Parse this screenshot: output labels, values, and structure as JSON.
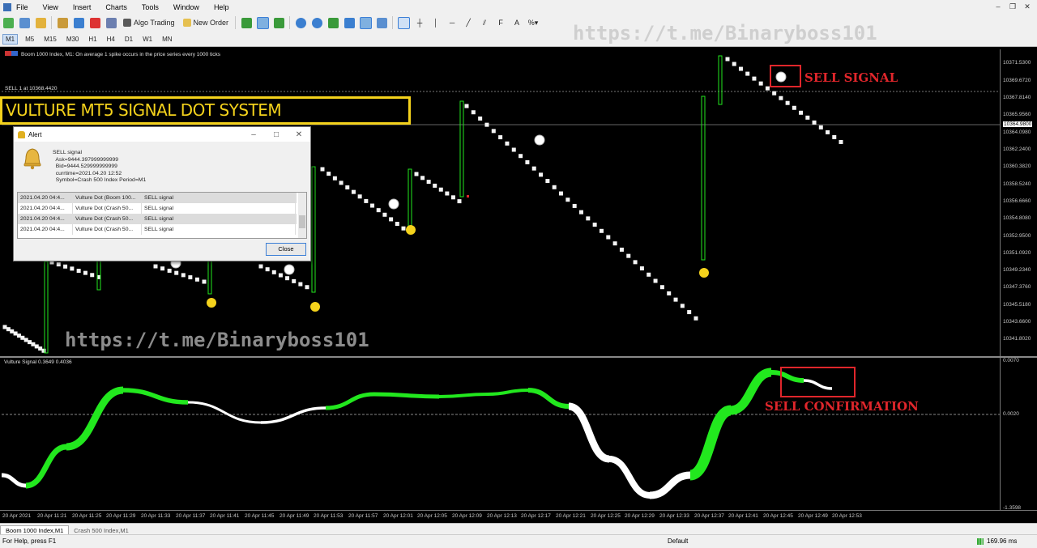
{
  "menu": [
    "File",
    "View",
    "Insert",
    "Charts",
    "Tools",
    "Window",
    "Help"
  ],
  "toolbar": {
    "algo_label": "Algo Trading",
    "order_label": "New Order",
    "pct_label": "%"
  },
  "timeframes": [
    "M1",
    "M5",
    "M15",
    "M30",
    "H1",
    "H4",
    "D1",
    "W1",
    "MN"
  ],
  "active_timeframe": "M1",
  "chart": {
    "header": "Boom 1000 Index, M1:  On average 1 spike occurs in the price series every 1000 ticks",
    "sell_line": "SELL 1 at 10368.4420",
    "banner": "VULTURE MT5 SIGNAL DOT SYSTEM",
    "watermark": "https://t.me/Binaryboss101",
    "sell_signal": "SELL SIGNAL",
    "sell_confirmation": "SELL CONFIRMATION",
    "indicator_header": "Vulture Signal 0.3649 0.4036",
    "price_axis": [
      "10371.5300",
      "10369.6720",
      "10367.8140",
      "10365.9560",
      "10364.0980",
      "10362.2400",
      "10360.3820",
      "10358.5240",
      "10356.6660",
      "10354.8080",
      "10352.9500",
      "10351.0920",
      "10349.2340",
      "10347.3760",
      "10345.5180",
      "10343.6600",
      "10341.8020"
    ],
    "current_price": "10364.9800",
    "indicator_axis": [
      "0.0070",
      "0.0020",
      "-1.3598"
    ],
    "time_axis": [
      "20 Apr 2021",
      "20 Apr 11:21",
      "20 Apr 11:25",
      "20 Apr 11:29",
      "20 Apr 11:33",
      "20 Apr 11:37",
      "20 Apr 11:41",
      "20 Apr 11:45",
      "20 Apr 11:49",
      "20 Apr 11:53",
      "20 Apr 11:57",
      "20 Apr 12:01",
      "20 Apr 12:05",
      "20 Apr 12:09",
      "20 Apr 12:13",
      "20 Apr 12:17",
      "20 Apr 12:21",
      "20 Apr 12:25",
      "20 Apr 12:29",
      "20 Apr 12:33",
      "20 Apr 12:37",
      "20 Apr 12:41",
      "20 Apr 12:45",
      "20 Apr 12:49",
      "20 Apr 12:53"
    ]
  },
  "alert": {
    "title": "Alert",
    "message": "SELL signal\n  Ask=9444.397999999999\n  Bid=9444.529999999999\n  currtime=2021.04.20 12:52\n  Symbol=Crash 500 Index Period=M1",
    "rows": [
      [
        "2021.04.20 04:4...",
        "Vulture Dot (Boom 100...",
        "SELL signal"
      ],
      [
        "2021.04.20 04:4...",
        "Vulture Dot (Crash 50...",
        "SELL signal"
      ],
      [
        "2021.04.20 04:4...",
        "Vulture Dot (Crash 50...",
        "SELL signal"
      ],
      [
        "2021.04.20 04:4...",
        "Vulture Dot (Crash 50...",
        "SELL signal"
      ]
    ],
    "close_label": "Close"
  },
  "tabs": [
    "Boom 1000 Index,M1",
    "Crash 500 Index,M1"
  ],
  "status": {
    "help": "For Help, press F1",
    "profile": "Default",
    "traffic": "169.96 ms"
  },
  "colors": {
    "green": "#22e81e",
    "yellow": "#f4d21c",
    "red": "#e0262b",
    "background": "#000000"
  }
}
